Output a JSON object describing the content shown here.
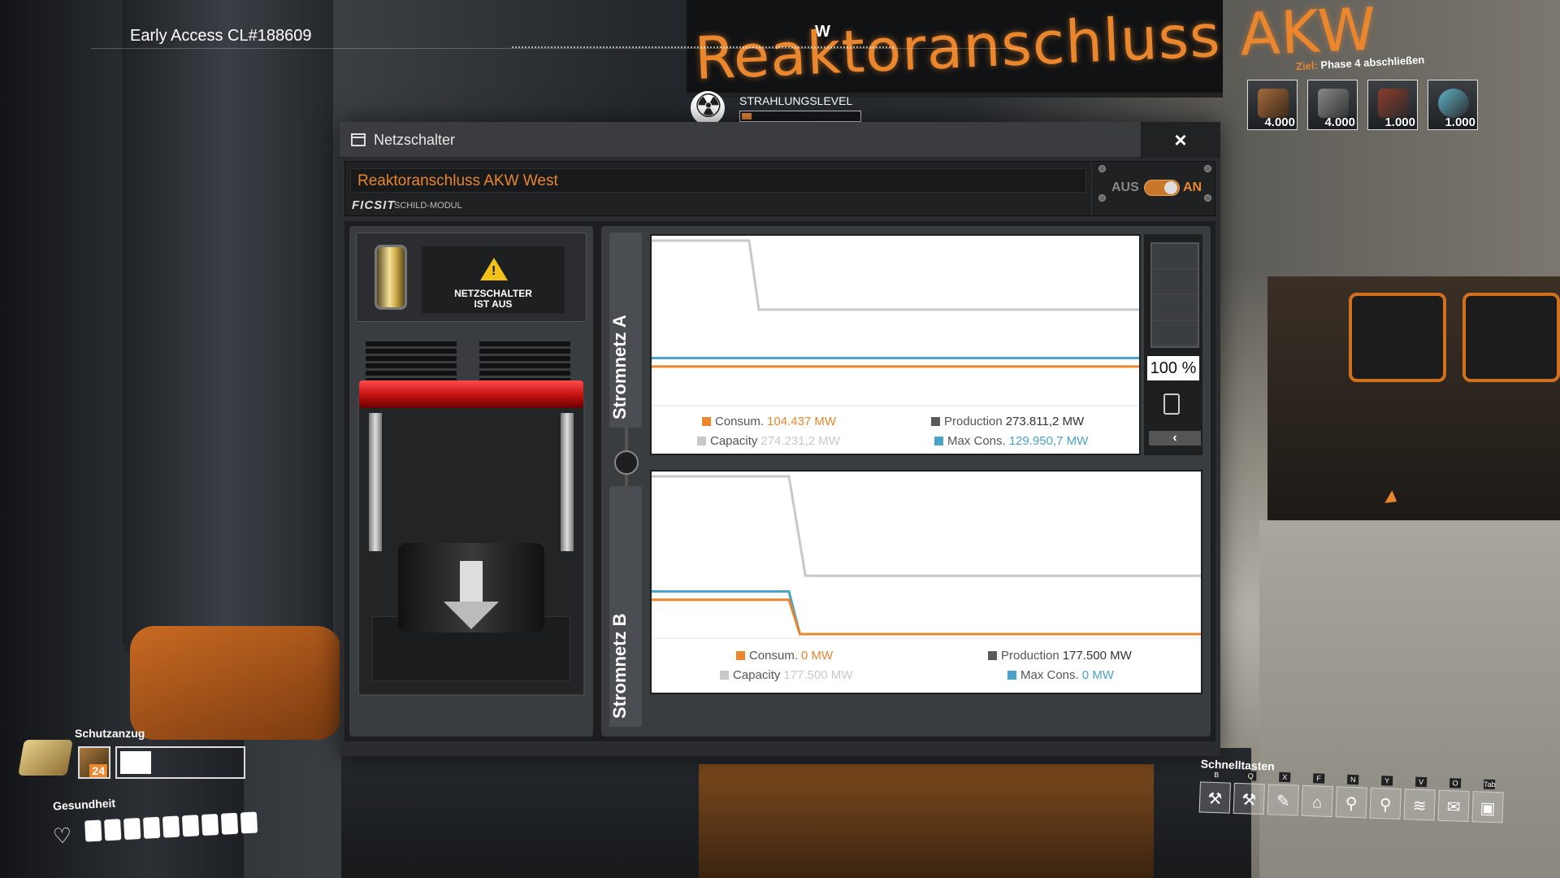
{
  "hud": {
    "build_label": "Early Access CL#188609",
    "compass_heading": "W",
    "sign_text": "Reaktoranschluss AKW",
    "radiation": {
      "label": "STRAHLUNGSLEVEL",
      "level_fraction": 0.08,
      "icon": "radiation-icon"
    },
    "goal": {
      "prefix": "Ziel:",
      "title": "Phase 4 abschließen",
      "items": [
        {
          "count": "4.000",
          "icon": "part-icon"
        },
        {
          "count": "4.000",
          "icon": "part-icon"
        },
        {
          "count": "1.000",
          "icon": "part-icon"
        },
        {
          "count": "1.000",
          "icon": "part-icon"
        }
      ]
    },
    "suit": {
      "label": "Schutzanzug",
      "slot_count": "24",
      "fill_fraction": 0.25
    },
    "health": {
      "label": "Gesundheit",
      "cells": 9
    },
    "quickbar": {
      "label": "Schnelltasten",
      "slots": [
        {
          "key": "B",
          "icon": "build-gun-icon",
          "glyph": "⚒"
        },
        {
          "key": "Q",
          "icon": "dismantle-icon",
          "glyph": "⚒"
        },
        {
          "key": "X",
          "icon": "paint-icon",
          "glyph": "✎"
        },
        {
          "key": "F",
          "icon": "blueprint-icon",
          "glyph": "⌂"
        },
        {
          "key": "N",
          "icon": "search-icon",
          "glyph": "⚲"
        },
        {
          "key": "Y",
          "icon": "map-pin-icon",
          "glyph": "⚲"
        },
        {
          "key": "V",
          "icon": "signal-icon",
          "glyph": "≋"
        },
        {
          "key": "O",
          "icon": "mail-icon",
          "glyph": "✉"
        },
        {
          "key": "Tab",
          "icon": "inventory-cube-icon",
          "glyph": "▣"
        }
      ]
    }
  },
  "window": {
    "title": "Netzschalter",
    "close_glyph": "×",
    "name_value": "Reaktoranschluss AKW West",
    "brand": "FICSIT",
    "brand_sub": "SCHILD-MODUL",
    "toggle": {
      "off_label": "AUS",
      "on_label": "AN",
      "state": "on"
    },
    "warning": {
      "line1": "NETZSCHALTER",
      "line2": "IST AUS"
    },
    "grid_a": {
      "tab_label": "Stromnetz A",
      "legend": {
        "consum_label": "Consum.",
        "consum_value": "104.437 MW",
        "production_label": "Production",
        "production_value": "273.811,2 MW",
        "capacity_label": "Capacity",
        "capacity_value": "274.231,2 MW",
        "maxcons_label": "Max Cons.",
        "maxcons_value": "129.950,7 MW"
      },
      "battery_percent": "100 %",
      "battery_back_glyph": "‹"
    },
    "grid_b": {
      "tab_label": "Stromnetz B",
      "legend": {
        "consum_label": "Consum.",
        "consum_value": "0 MW",
        "production_label": "Production",
        "production_value": "177.500 MW",
        "capacity_label": "Capacity",
        "capacity_value": "177.500 MW",
        "maxcons_label": "Max Cons.",
        "maxcons_value": "0 MW"
      }
    }
  },
  "colors": {
    "accent": "#e9862e",
    "consumption": "#e9862e",
    "production": "#5b5b5b",
    "capacity": "#c8c8c8",
    "max_consumption": "#4aa3c8"
  },
  "chart_data": [
    {
      "type": "line",
      "series": [
        {
          "name": "Capacity",
          "color": "#c8c8c8",
          "x": [
            0,
            0.2,
            0.22,
            0.25,
            1
          ],
          "y": [
            480000,
            480000,
            274231.2,
            274231.2,
            274231.2
          ]
        },
        {
          "name": "Max Cons.",
          "color": "#4aa3c8",
          "x": [
            0,
            1
          ],
          "y": [
            129950.7,
            129950.7
          ]
        },
        {
          "name": "Consum.",
          "color": "#e9862e",
          "x": [
            0,
            1
          ],
          "y": [
            104437,
            104437
          ]
        }
      ],
      "ylim": [
        0,
        480000
      ]
    },
    {
      "type": "line",
      "series": [
        {
          "name": "Capacity",
          "color": "#c8c8c8",
          "x": [
            0,
            0.25,
            0.28,
            1
          ],
          "y": [
            480000,
            480000,
            177500,
            177500
          ]
        },
        {
          "name": "Max Cons.",
          "color": "#4aa3c8",
          "x": [
            0,
            0.25,
            0.27,
            1
          ],
          "y": [
            129950.7,
            129950.7,
            0,
            0
          ]
        },
        {
          "name": "Consum.",
          "color": "#e9862e",
          "x": [
            0,
            0.25,
            0.27,
            1
          ],
          "y": [
            104437,
            104437,
            0,
            0
          ]
        }
      ],
      "ylim": [
        0,
        480000
      ]
    }
  ]
}
